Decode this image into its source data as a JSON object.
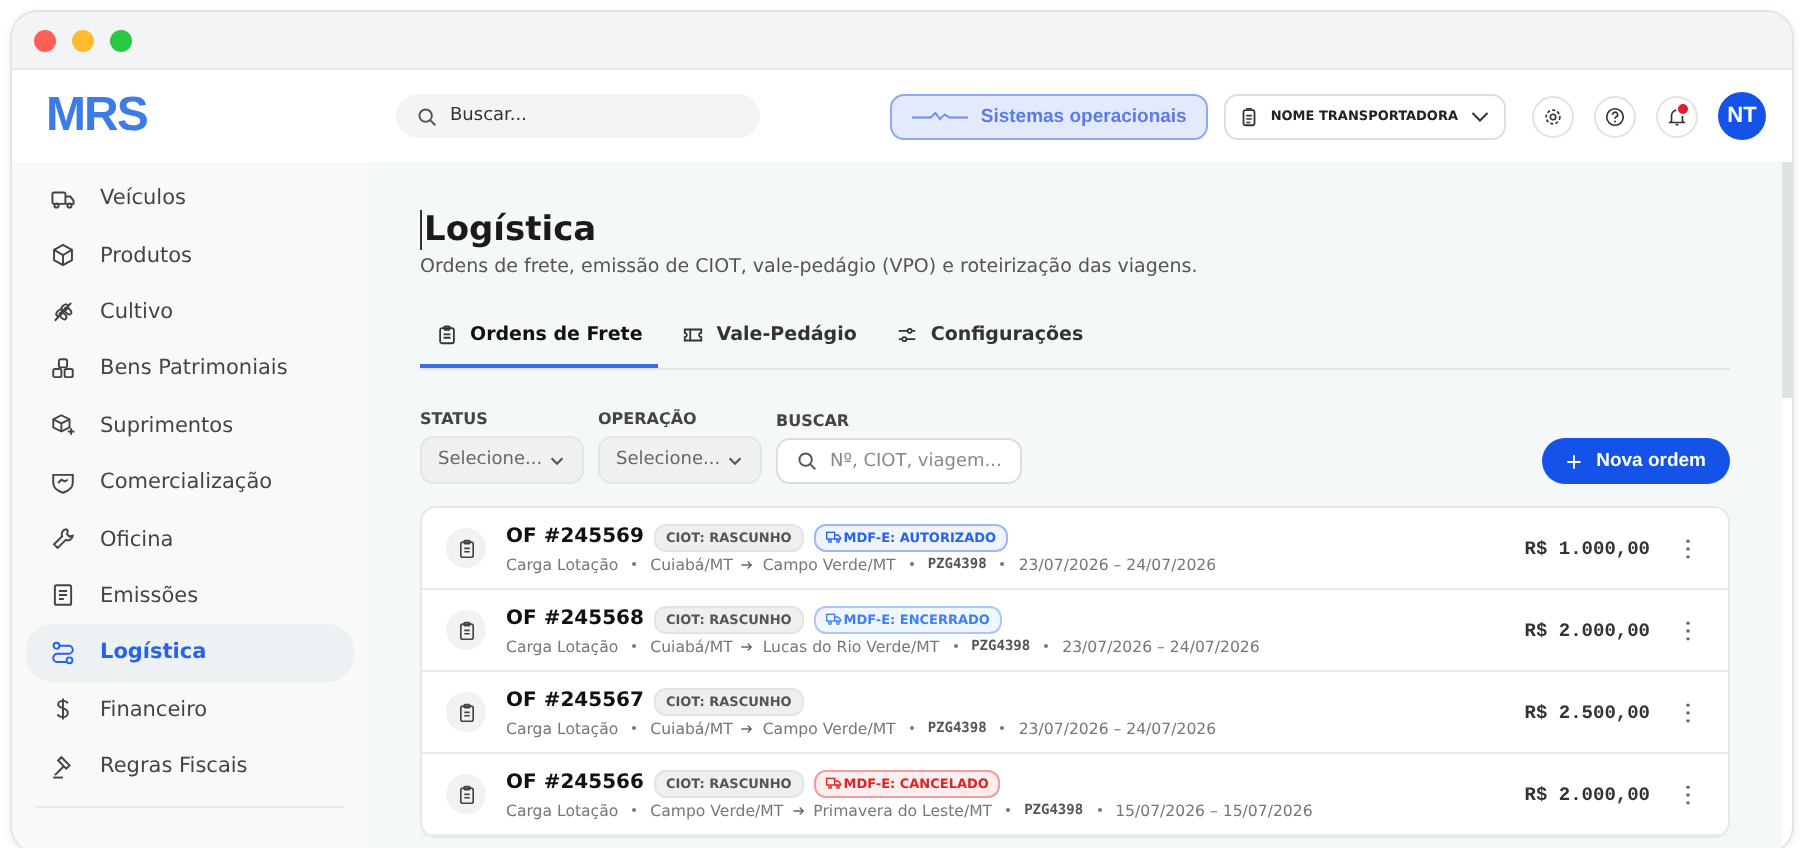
{
  "header": {
    "logo": "MRS",
    "search": {
      "placeholder": "Buscar..."
    },
    "status": "Sistemas operacionais",
    "company": "NOME TRANSPORTADORA",
    "notifications": {
      "unread": true
    },
    "avatar": "NT"
  },
  "sidebar": {
    "items": [
      {
        "label": "Veículos",
        "selected": false
      },
      {
        "label": "Produtos",
        "selected": false
      },
      {
        "label": "Cultivo",
        "selected": false
      },
      {
        "label": "Bens Patrimoniais",
        "selected": false
      },
      {
        "label": "Suprimentos",
        "selected": false
      },
      {
        "label": "Comercialização",
        "selected": false
      },
      {
        "label": "Oficina",
        "selected": false
      },
      {
        "label": "Emissões",
        "selected": false
      },
      {
        "label": "Logística",
        "selected": true
      },
      {
        "label": "Financeiro",
        "selected": false
      },
      {
        "label": "Regras Fiscais",
        "selected": false
      }
    ]
  },
  "page": {
    "title": "Logística",
    "subtitle": "Ordens de frete, emissão de CIOT, vale-pedágio (VPO) e roteirização das viagens."
  },
  "tabs": [
    {
      "label": "Ordens de Frete",
      "selected": true
    },
    {
      "label": "Vale-Pedágio",
      "selected": false
    },
    {
      "label": "Configurações",
      "selected": false
    }
  ],
  "filters": [
    {
      "kind": "select",
      "label": "STATUS",
      "placeholder": "Selecione..."
    },
    {
      "kind": "select",
      "label": "OPERAÇÃO",
      "placeholder": "Selecione..."
    },
    {
      "kind": "search",
      "label": "BUSCAR",
      "placeholder": "Nº, CIOT, viagem..."
    }
  ],
  "new_button": "Nova ordem",
  "orders": [
    {
      "number": "OF #245569",
      "ciot": "CIOT: RASCUNHO",
      "mdfe": {
        "label": "MDF-E: AUTORIZADO",
        "color": "#2563eb"
      },
      "type": "Carga Lotação",
      "origin": "Cuiabá/MT",
      "destination": "Campo Verde/MT",
      "plate": "PZG4398",
      "dates": "23/07/2026 – 24/07/2026",
      "value": "R$ 1.000,00"
    },
    {
      "number": "OF #245568",
      "ciot": "CIOT: RASCUNHO",
      "mdfe": {
        "label": "MDF-E: ENCERRADO",
        "color": "#3b82f6"
      },
      "type": "Carga Lotação",
      "origin": "Cuiabá/MT",
      "destination": "Lucas do Rio Verde/MT",
      "plate": "PZG4398",
      "dates": "23/07/2026 – 24/07/2026",
      "value": "R$ 2.000,00"
    },
    {
      "number": "OF #245567",
      "ciot": "CIOT: RASCUNHO",
      "type": "Carga Lotação",
      "origin": "Cuiabá/MT",
      "destination": "Campo Verde/MT",
      "plate": "PZG4398",
      "dates": "23/07/2026 – 24/07/2026",
      "value": "R$ 2.500,00"
    },
    {
      "number": "OF #245566",
      "ciot": "CIOT: RASCUNHO",
      "mdfe": {
        "label": "MDF-E: CANCELADO",
        "color": "#dc2626"
      },
      "type": "Carga Lotação",
      "origin": "Campo Verde/MT",
      "destination": "Primavera do Leste/MT",
      "plate": "PZG4398",
      "dates": "15/07/2026 – 15/07/2026",
      "value": "R$ 2.000,00"
    }
  ]
}
